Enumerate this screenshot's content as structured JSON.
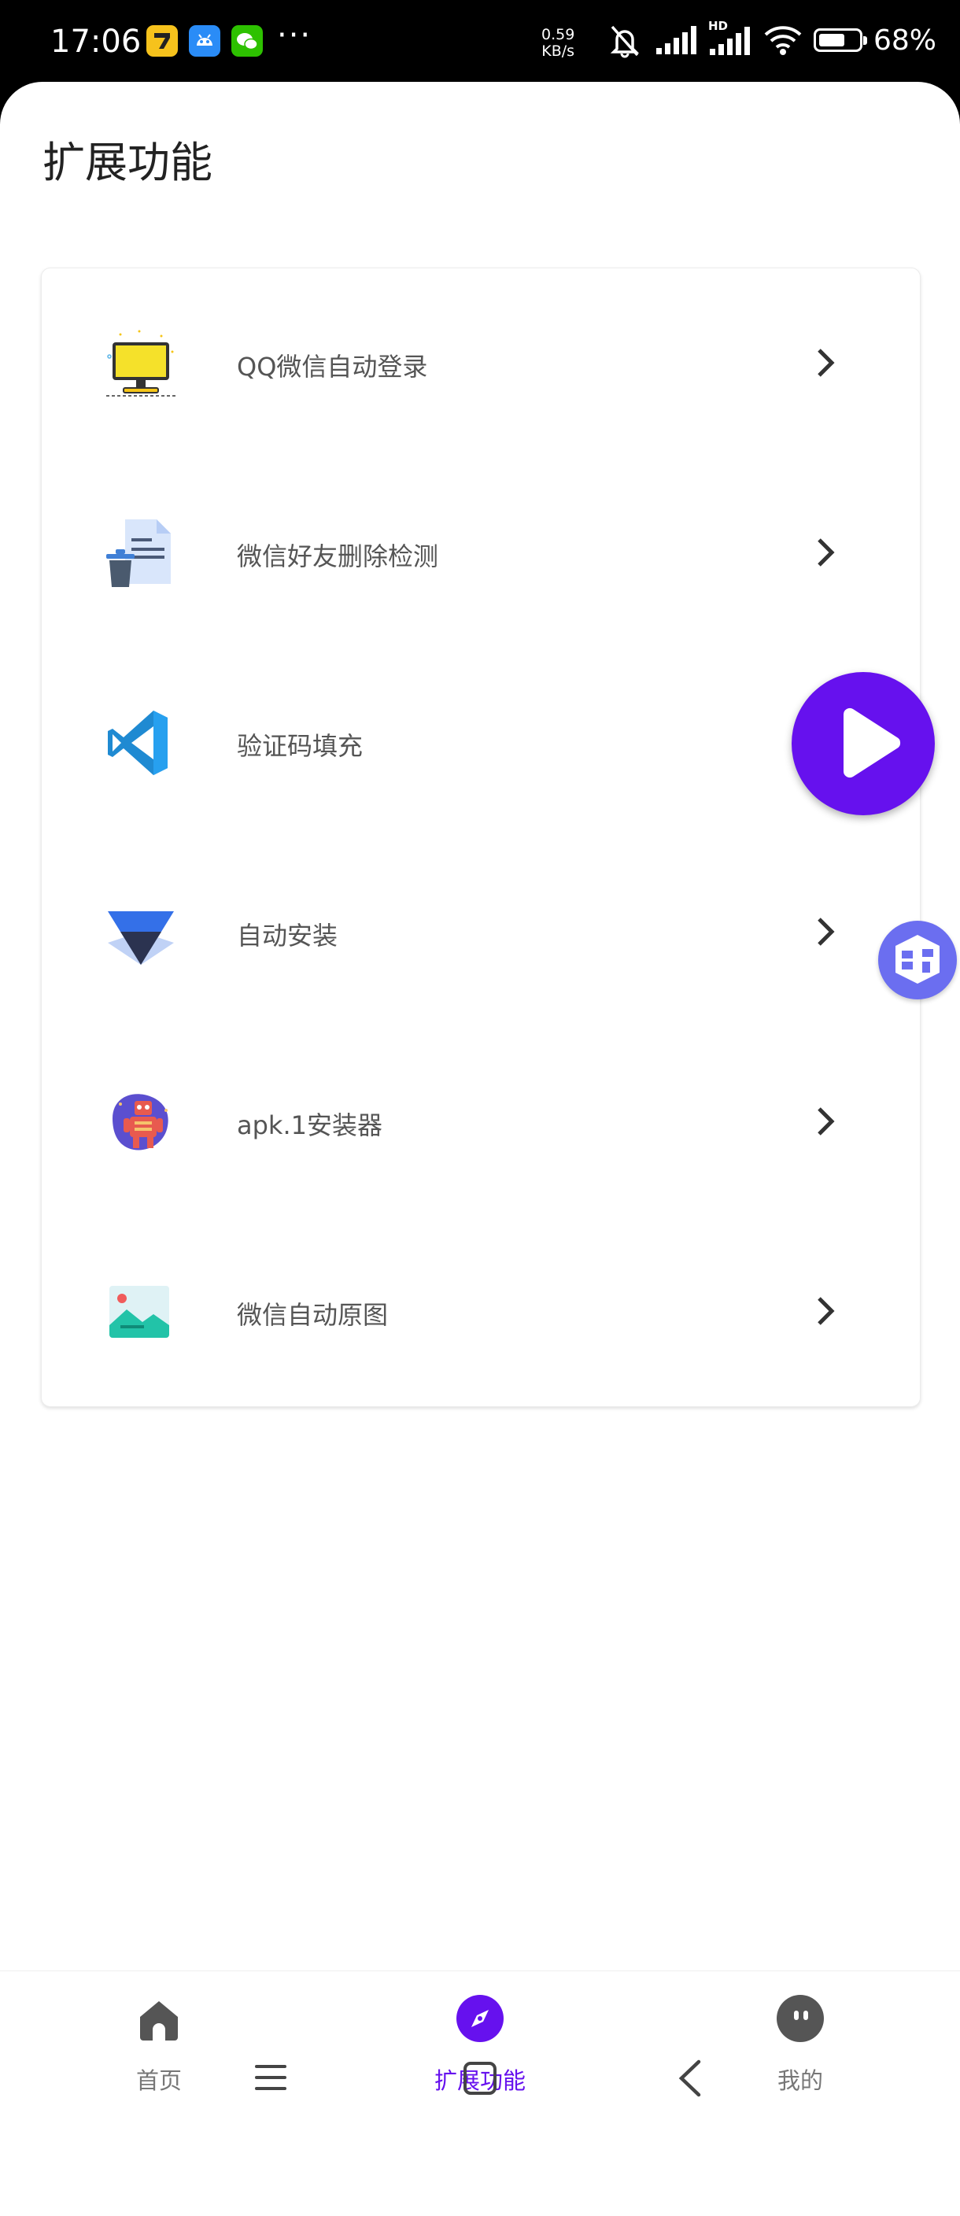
{
  "status_bar": {
    "time": "17:06",
    "more": "···",
    "net_speed_value": "0.59",
    "net_speed_unit": "KB/s",
    "hd_label": "HD",
    "battery_percent": "68%",
    "battery_level": 0.68
  },
  "page": {
    "title": "扩展功能"
  },
  "features": [
    {
      "label": "QQ微信自动登录",
      "icon": "monitor-icon"
    },
    {
      "label": "微信好友删除检测",
      "icon": "document-trash-icon"
    },
    {
      "label": "验证码填充",
      "icon": "vscode-icon"
    },
    {
      "label": "自动安装",
      "icon": "triangle-install-icon"
    },
    {
      "label": "apk.1安装器",
      "icon": "robot-icon"
    },
    {
      "label": "微信自动原图",
      "icon": "image-icon"
    }
  ],
  "bottom_nav": [
    {
      "label": "首页",
      "icon": "home-icon",
      "active": false
    },
    {
      "label": "扩展功能",
      "icon": "compass-icon",
      "active": true
    },
    {
      "label": "我的",
      "icon": "profile-face-icon",
      "active": false
    }
  ],
  "colors": {
    "accent": "#6611ee",
    "fab_secondary": "#6b6ef0"
  }
}
